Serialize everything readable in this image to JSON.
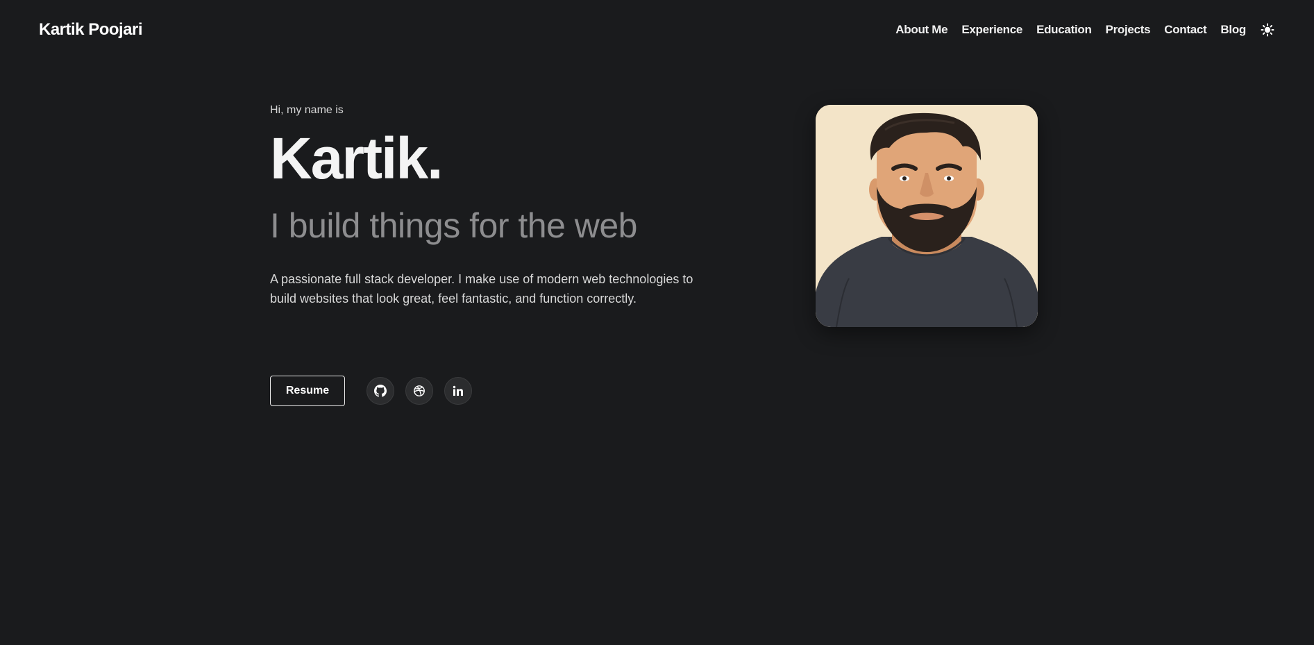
{
  "header": {
    "brand": "Kartik Poojari",
    "nav": [
      {
        "label": "About Me"
      },
      {
        "label": "Experience"
      },
      {
        "label": "Education"
      },
      {
        "label": "Projects"
      },
      {
        "label": "Contact"
      },
      {
        "label": "Blog"
      }
    ],
    "theme_toggle_icon": "sun-icon"
  },
  "hero": {
    "greeting": "Hi, my name is",
    "name": "Kartik.",
    "tagline": "I build things for the web",
    "description": "A passionate full stack developer. I make use of modern web technologies to build websites that look great, feel fantastic, and function correctly.",
    "resume_label": "Resume",
    "socials": [
      {
        "icon": "github-icon"
      },
      {
        "icon": "dribbble-icon"
      },
      {
        "icon": "linkedin-icon"
      }
    ]
  },
  "avatar": {
    "icon": "avatar-illustration"
  },
  "colors": {
    "background": "#1a1b1d",
    "text": "#f2f2f2",
    "muted": "#8d8d8f",
    "avatar_bg": "#f3e4c8"
  }
}
